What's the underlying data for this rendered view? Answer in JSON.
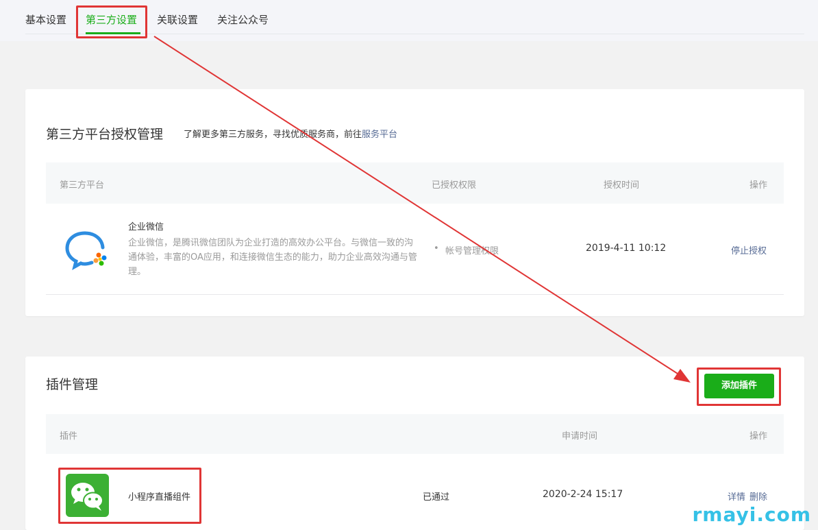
{
  "tabs": [
    {
      "label": "基本设置"
    },
    {
      "label": "第三方设置"
    },
    {
      "label": "关联设置"
    },
    {
      "label": "关注公众号"
    }
  ],
  "third_party": {
    "title": "第三方平台授权管理",
    "desc_prefix": "了解更多第三方服务，寻找优质服务商，前往",
    "desc_link": "服务平台",
    "headers": {
      "platform": "第三方平台",
      "permissions": "已授权权限",
      "time": "授权时间",
      "action": "操作"
    },
    "row": {
      "name": "企业微信",
      "description": "企业微信，是腾讯微信团队为企业打造的高效办公平台。与微信一致的沟通体验，丰富的OA应用，和连接微信生态的能力，助力企业高效沟通与管理。",
      "permission": "帐号管理权限",
      "time": "2019-4-11 10:12",
      "action": "停止授权"
    }
  },
  "plugins": {
    "title": "插件管理",
    "add_button": "添加插件",
    "headers": {
      "plugin": "插件",
      "apply_time": "申请时间",
      "action": "操作"
    },
    "row": {
      "name": "小程序直播组件",
      "status": "已通过",
      "time": "2020-2-24 15:17",
      "detail": "详情",
      "delete": "删除"
    }
  },
  "watermark": "rmayi.com",
  "colors": {
    "accent": "#1aad19",
    "link": "#576b95",
    "annotation": "#e03535"
  },
  "icons": {
    "wework": "wework-logo-icon",
    "wechat": "wechat-logo-icon"
  }
}
